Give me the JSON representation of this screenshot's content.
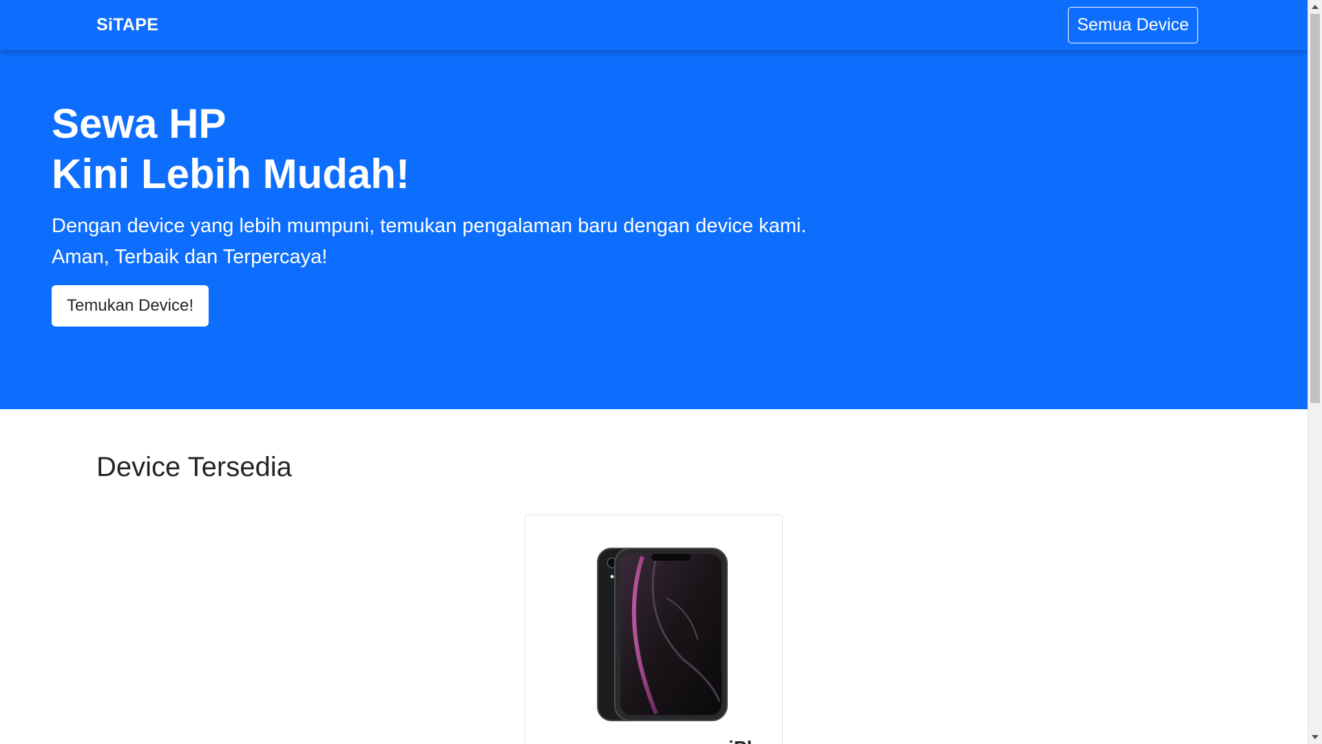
{
  "navbar": {
    "brand": "SiTAPE",
    "nav_button": "Semua Device"
  },
  "hero": {
    "title_line1": "Sewa HP",
    "title_line2": "Kini Lebih Mudah!",
    "subtitle_line1": "Dengan device yang lebih mumpuni, temukan pengalaman baru dengan device kami.",
    "subtitle_line2": "Aman, Terbaik dan Terpercaya!",
    "cta_button": "Temukan Device!"
  },
  "section": {
    "title": "Device Tersedia"
  },
  "products": [
    {
      "name": "iPhone XR",
      "image_icon": "iphone-xr-image"
    }
  ],
  "colors": {
    "primary": "#0d6efd",
    "text_dark": "#212529",
    "white": "#ffffff"
  }
}
